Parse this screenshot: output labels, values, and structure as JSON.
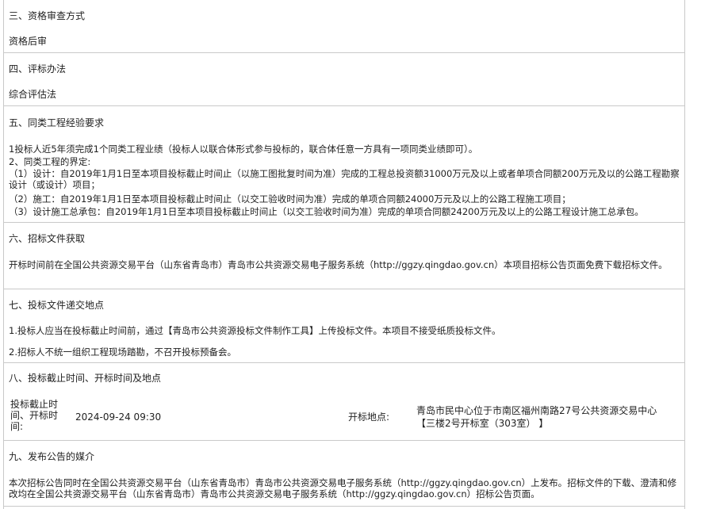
{
  "s3": {
    "heading": "三、资格审查方式",
    "body": "资格后审"
  },
  "s4": {
    "heading": "四、评标办法",
    "body": "综合评估法"
  },
  "s5": {
    "heading": "五、同类工程经验要求",
    "lines": [
      "1投标人近5年须完成1个同类工程业绩（投标人以联合体形式参与投标的，联合体任意一方具有一项同类业绩即可）。",
      "2、同类工程的界定:",
      "（1）设计：自2019年1月1日至本项目投标截止时间止（以施工图批复时间为准）完成的工程总投资额31000万元及以上或者单项合同额200万元及以的公路工程勘察设计（或设计）项目；",
      "（2）施工：自2019年1月1日至本项目投标截止时间止（以交工验收时间为准）完成的单项合同额24000万元及以上的公路工程施工项目；",
      "（3）设计施工总承包：自2019年1月1日至本项目投标截止时间止（以交工验收时间为准）完成的单项合同额24200万元及以上的公路工程设计施工总承包。"
    ]
  },
  "s6": {
    "heading": "六、招标文件获取",
    "body": "开标时间前在全国公共资源交易平台（山东省青岛市）青岛市公共资源交易电子服务系统（http://ggzy.qingdao.gov.cn）本项目招标公告页面免费下载招标文件。"
  },
  "s7": {
    "heading": "七、投标文件递交地点",
    "lines": [
      "1.投标人应当在投标截止时间前，通过【青岛市公共资源投标文件制作工具】上传投标文件。本项目不接受纸质投标文件。",
      "2.招标人不统一组织工程现场踏勘，不召开投标预备会。"
    ]
  },
  "s8": {
    "heading": "八、投标截止时间、开标时间及地点",
    "deadline_label_1": "投标截止时",
    "deadline_label_2": "间、开标时",
    "deadline_label_3": "间:",
    "deadline_value": "2024-09-24 09:30",
    "venue_label": "开标地点:",
    "venue_value_1": "青岛市民中心位于市南区福州南路27号公共资源交易中心",
    "venue_value_2": "【三楼2号开标室（303室）  】"
  },
  "s9": {
    "heading": "九、发布公告的媒介",
    "body": "本次招标公告同时在全国公共资源交易平台（山东省青岛市）青岛市公共资源交易电子服务系统（http://ggzy.qingdao.gov.cn）上发布。招标文件的下载、澄清和修改均在全国公共资源交易平台（山东省青岛市）青岛市公共资源交易电子服务系统（http://ggzy.qingdao.gov.cn）招标公告页面。"
  }
}
